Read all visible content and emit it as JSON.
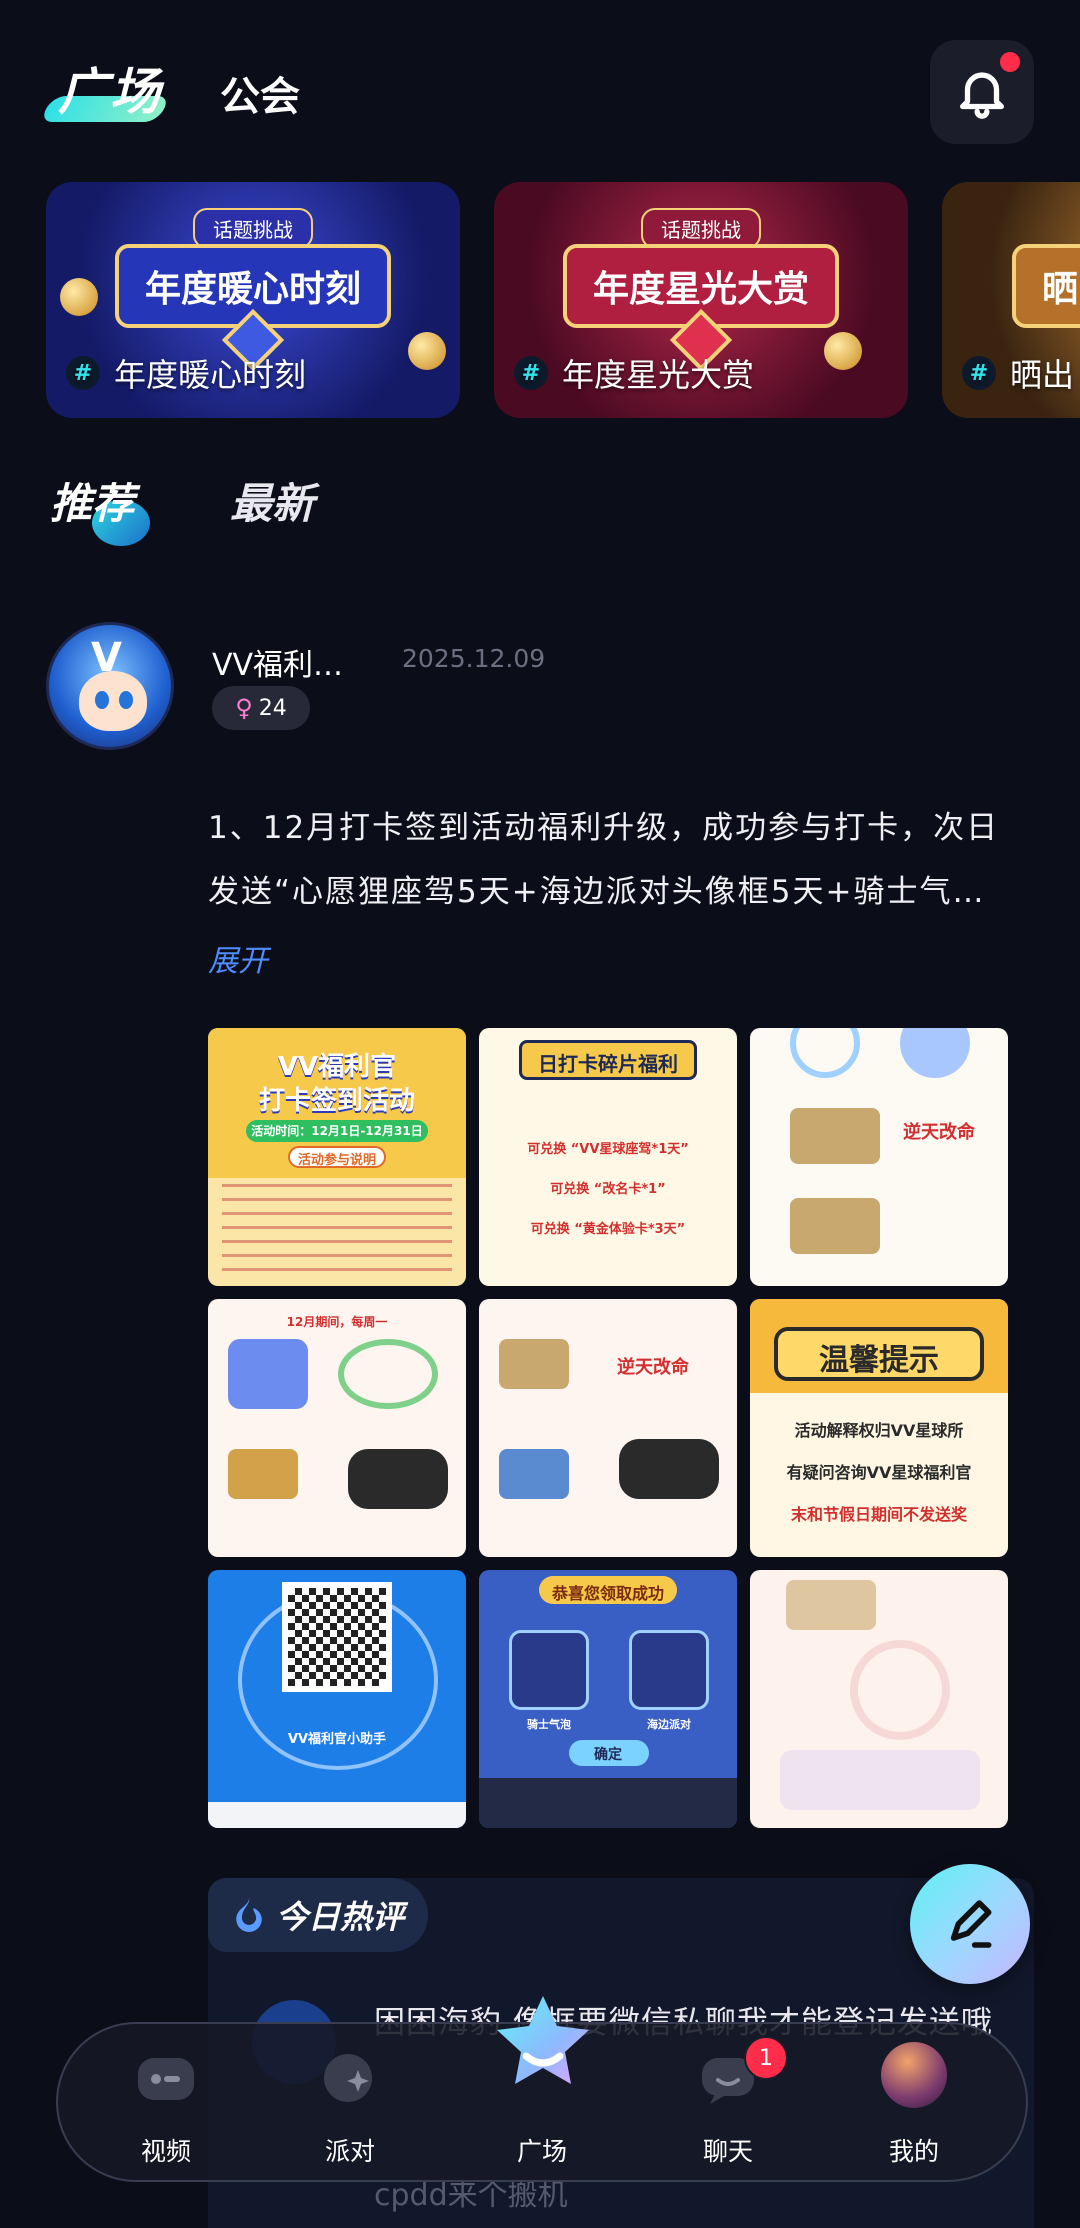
{
  "header": {
    "tab_square": "广场",
    "tab_guild": "公会"
  },
  "topics": [
    {
      "banner_badge": "话题挑战",
      "banner_title": "年度暖心时刻",
      "label": "年度暖心时刻",
      "bg": "#1c2a8a"
    },
    {
      "banner_badge": "话题挑战",
      "banner_title": "年度星光大赏",
      "label": "年度星光大赏",
      "bg": "#6b1130"
    },
    {
      "banner_badge": "",
      "banner_title": "晒",
      "label": "晒出",
      "bg": "#3a2410"
    }
  ],
  "feed_tabs": {
    "recommended": "推荐",
    "latest": "最新"
  },
  "post": {
    "author": "VV福利…",
    "date": "2025.12.09",
    "level": "24",
    "text_line1": "1、12月打卡签到活动福利升级，成功参与打卡，次日",
    "text_line2": "发送“心愿狸座驾5天+海边派对头像框5天+骑士气…",
    "expand": "展开",
    "images": [
      {
        "title": "VV福利官",
        "subtitle": "打卡签到活动",
        "note": "活动时间：12月1日-12月31日",
        "footer": "活动参与说明"
      },
      {
        "title": "日打卡碎片福利",
        "line1": "可兑换 “VV星球座驾*1天”",
        "line2": "可兑换 “改名卡*1”",
        "line3": "可兑换 “黄金体验卡*3天”"
      },
      {
        "title": "逆天改命"
      },
      {
        "title": "12月期间，每周一"
      },
      {
        "title": "逆天改命"
      },
      {
        "title": "温馨提示",
        "line1": "活动解释权归VV星球所",
        "line2": "有疑问咨询VV星球福利官",
        "line3": "末和节假日期间不发送奖"
      },
      {
        "title": "VV福利官小助手"
      },
      {
        "title": "恭喜您领取成功",
        "left": "骑士气泡",
        "right": "海边派对",
        "confirm": "确定"
      },
      {
        "title": ""
      }
    ]
  },
  "hot_comment": {
    "label": "今日热评",
    "text": "困困海豹 像框要微信私聊我才能登记发送哦",
    "next": "cpdd来个搬机"
  },
  "bottom_nav": [
    {
      "label": "视频",
      "icon": "video-icon"
    },
    {
      "label": "派对",
      "icon": "party-icon"
    },
    {
      "label": "广场",
      "icon": "square-icon"
    },
    {
      "label": "聊天",
      "icon": "chat-icon",
      "badge": "1"
    },
    {
      "label": "我的",
      "icon": "profile-icon"
    }
  ],
  "colors": {
    "background": "#0b0d18",
    "accent_cyan": "#34e3ea",
    "link_blue": "#4f8cff",
    "badge_red": "#ff2d4a"
  }
}
